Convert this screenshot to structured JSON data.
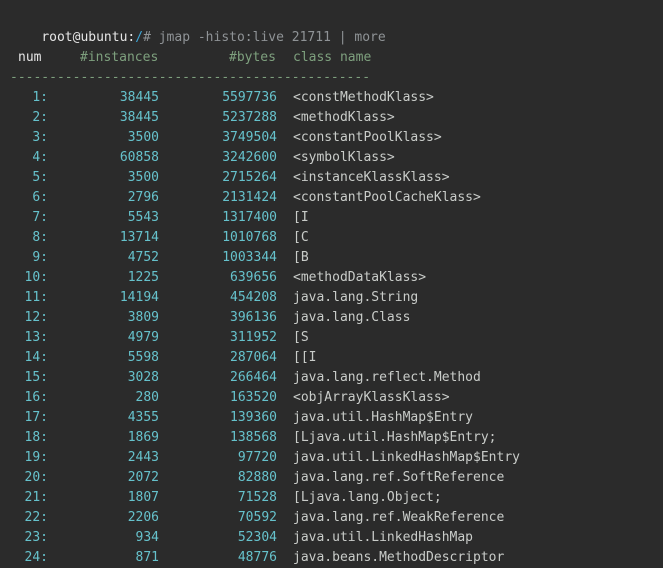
{
  "prompt": {
    "user_host": "root@ubuntu",
    "separator": ":",
    "path": "/",
    "symbol": "#",
    "command": " jmap -histo:live 21711 | more"
  },
  "header": {
    "num": "num",
    "instances": "#instances",
    "bytes": "#bytes",
    "class_name": "class name"
  },
  "separator_line": "----------------------------------------------",
  "rows": [
    {
      "num": "1:",
      "instances": "38445",
      "bytes": "5597736",
      "class_name": "<constMethodKlass>"
    },
    {
      "num": "2:",
      "instances": "38445",
      "bytes": "5237288",
      "class_name": "<methodKlass>"
    },
    {
      "num": "3:",
      "instances": "3500",
      "bytes": "3749504",
      "class_name": "<constantPoolKlass>"
    },
    {
      "num": "4:",
      "instances": "60858",
      "bytes": "3242600",
      "class_name": "<symbolKlass>"
    },
    {
      "num": "5:",
      "instances": "3500",
      "bytes": "2715264",
      "class_name": "<instanceKlassKlass>"
    },
    {
      "num": "6:",
      "instances": "2796",
      "bytes": "2131424",
      "class_name": "<constantPoolCacheKlass>"
    },
    {
      "num": "7:",
      "instances": "5543",
      "bytes": "1317400",
      "class_name": "[I"
    },
    {
      "num": "8:",
      "instances": "13714",
      "bytes": "1010768",
      "class_name": "[C"
    },
    {
      "num": "9:",
      "instances": "4752",
      "bytes": "1003344",
      "class_name": "[B"
    },
    {
      "num": "10:",
      "instances": "1225",
      "bytes": "639656",
      "class_name": "<methodDataKlass>"
    },
    {
      "num": "11:",
      "instances": "14194",
      "bytes": "454208",
      "class_name": "java.lang.String"
    },
    {
      "num": "12:",
      "instances": "3809",
      "bytes": "396136",
      "class_name": "java.lang.Class"
    },
    {
      "num": "13:",
      "instances": "4979",
      "bytes": "311952",
      "class_name": "[S"
    },
    {
      "num": "14:",
      "instances": "5598",
      "bytes": "287064",
      "class_name": "[[I"
    },
    {
      "num": "15:",
      "instances": "3028",
      "bytes": "266464",
      "class_name": "java.lang.reflect.Method"
    },
    {
      "num": "16:",
      "instances": "280",
      "bytes": "163520",
      "class_name": "<objArrayKlassKlass>"
    },
    {
      "num": "17:",
      "instances": "4355",
      "bytes": "139360",
      "class_name": "java.util.HashMap$Entry"
    },
    {
      "num": "18:",
      "instances": "1869",
      "bytes": "138568",
      "class_name": "[Ljava.util.HashMap$Entry;"
    },
    {
      "num": "19:",
      "instances": "2443",
      "bytes": "97720",
      "class_name": "java.util.LinkedHashMap$Entry"
    },
    {
      "num": "20:",
      "instances": "2072",
      "bytes": "82880",
      "class_name": "java.lang.ref.SoftReference"
    },
    {
      "num": "21:",
      "instances": "1807",
      "bytes": "71528",
      "class_name": "[Ljava.lang.Object;"
    },
    {
      "num": "22:",
      "instances": "2206",
      "bytes": "70592",
      "class_name": "java.lang.ref.WeakReference"
    },
    {
      "num": "23:",
      "instances": "934",
      "bytes": "52304",
      "class_name": "java.util.LinkedHashMap"
    },
    {
      "num": "24:",
      "instances": "871",
      "bytes": "48776",
      "class_name": "java.beans.MethodDescriptor"
    }
  ]
}
